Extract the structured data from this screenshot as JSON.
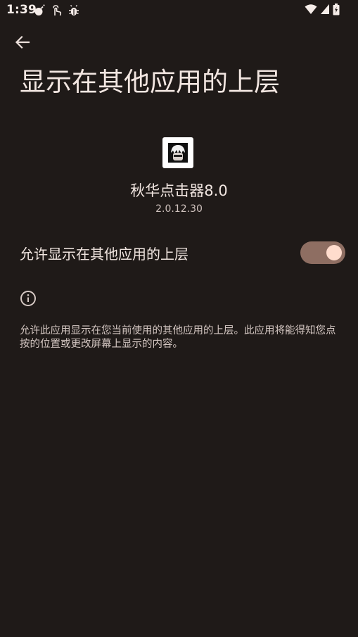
{
  "status_bar": {
    "time": "1:39",
    "notification_icons": [
      "bomb-icon",
      "touch-icon",
      "bug-icon"
    ],
    "system_icons": [
      "wifi-icon",
      "cell-signal-icon",
      "battery-icon"
    ]
  },
  "header": {
    "back_icon": "arrow-left-icon",
    "title": "显示在其他应用的上层"
  },
  "app": {
    "name": "秋华点击器8.0",
    "version": "2.0.12.30"
  },
  "permission": {
    "label": "允许显示在其他应用的上层",
    "enabled": true
  },
  "info": {
    "icon": "info-icon",
    "description": "允许此应用显示在您当前使用的其他应用的上层。此应用将能得知您点按的位置或更改屏幕上显示的内容。"
  },
  "colors": {
    "background": "#1f1a18",
    "toggle_track": "#8e6e62",
    "toggle_thumb": "#ffdccd"
  }
}
